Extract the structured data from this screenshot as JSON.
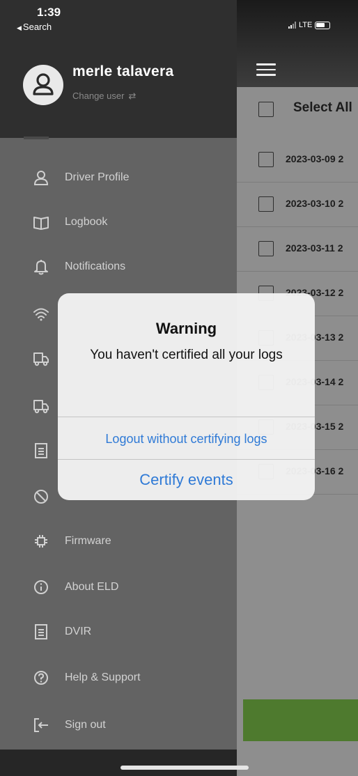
{
  "status_bar": {
    "time": "1:39",
    "back_label": "Search",
    "network": "LTE"
  },
  "drawer": {
    "user_name": "merle talavera",
    "change_user_label": "Change user",
    "menu_items": [
      {
        "label": "Driver Profile",
        "icon": "user-icon"
      },
      {
        "label": "Logbook",
        "icon": "book-icon"
      },
      {
        "label": "Notifications",
        "icon": "bell-icon"
      },
      {
        "label": "",
        "icon": "wifi-icon"
      },
      {
        "label": "",
        "icon": "truck-icon"
      },
      {
        "label": "",
        "icon": "truck-icon"
      },
      {
        "label": "",
        "icon": "clipboard-icon"
      },
      {
        "label": "",
        "icon": "no-entry-icon"
      },
      {
        "label": "Firmware",
        "icon": "chip-icon"
      },
      {
        "label": "About ELD",
        "icon": "info-icon"
      },
      {
        "label": "DVIR",
        "icon": "clipboard-icon"
      },
      {
        "label": "Help & Support",
        "icon": "help-icon"
      },
      {
        "label": "Sign out",
        "icon": "sign-out-icon"
      }
    ]
  },
  "main": {
    "select_all_label": "Select All",
    "log_dates": [
      "2023-03-09 2",
      "2023-03-10 2",
      "2023-03-11 2",
      "2023-03-12 2",
      "2023-03-13 2",
      "2023-03-14 2",
      "2023-03-15 2",
      "2023-03-16 2"
    ]
  },
  "alert": {
    "title": "Warning",
    "message": "You haven't certified all your logs",
    "secondary_action": "Logout without certifying logs",
    "primary_action": "Certify events"
  },
  "colors": {
    "drawer_header": "#2f2f2f",
    "drawer_menu": "#636363",
    "list_background": "#8e8e8e",
    "action_bar": "#4e7a2e",
    "alert_link": "#2f7ad6"
  }
}
